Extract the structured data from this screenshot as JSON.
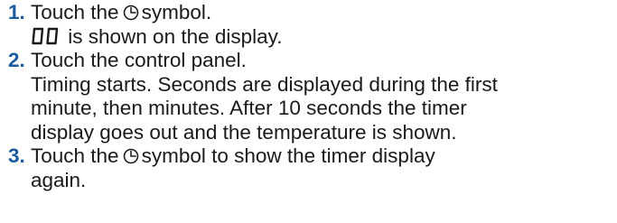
{
  "steps": [
    {
      "number": "1.",
      "pre": "Touch the",
      "icon": "clock-icon",
      "post": "symbol.",
      "result_display": "00",
      "result_text": "is shown on the display."
    },
    {
      "number": "2.",
      "text": "Touch the control panel.",
      "detail_lines": [
        "Timing starts. Seconds are displayed during the first",
        "minute, then minutes. After 10 seconds the timer",
        "display goes out and the temperature is shown."
      ]
    },
    {
      "number": "3.",
      "pre": "Touch the",
      "icon": "clock-icon",
      "post_lines": [
        "symbol to show the timer display",
        "again."
      ]
    }
  ],
  "colors": {
    "step_number": "#1a5a9e",
    "text": "#1a1a1a"
  }
}
